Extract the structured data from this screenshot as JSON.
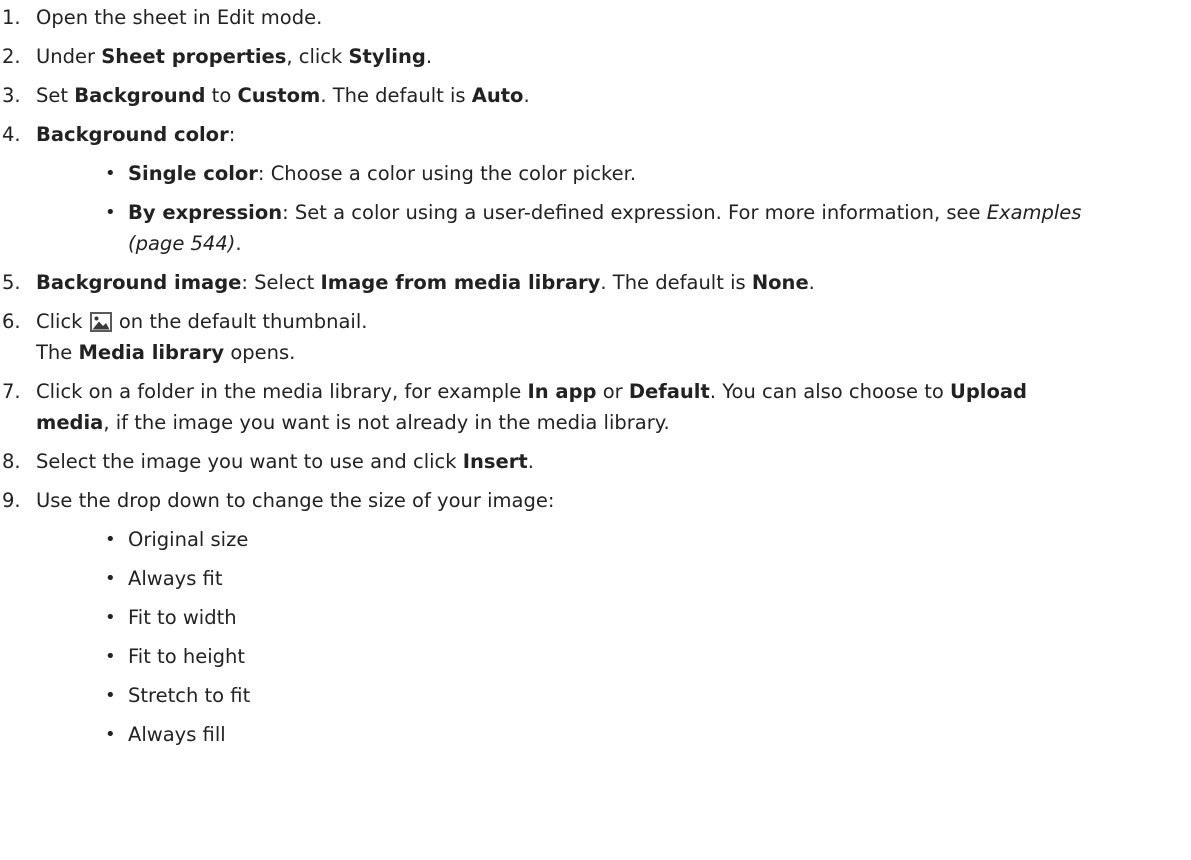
{
  "steps": [
    {
      "num": "1.",
      "parts": [
        {
          "t": "Open the sheet in Edit mode."
        }
      ]
    },
    {
      "num": "2.",
      "parts": [
        {
          "t": "Under "
        },
        {
          "t": "Sheet properties",
          "b": true
        },
        {
          "t": ", click "
        },
        {
          "t": "Styling",
          "b": true
        },
        {
          "t": "."
        }
      ]
    },
    {
      "num": "3.",
      "parts": [
        {
          "t": "Set "
        },
        {
          "t": "Background",
          "b": true
        },
        {
          "t": " to "
        },
        {
          "t": "Custom",
          "b": true
        },
        {
          "t": ". The default is "
        },
        {
          "t": "Auto",
          "b": true
        },
        {
          "t": "."
        }
      ]
    },
    {
      "num": "4.",
      "parts": [
        {
          "t": "Background color",
          "b": true
        },
        {
          "t": ":"
        }
      ]
    },
    {
      "num": "5.",
      "parts": [
        {
          "t": "Background image",
          "b": true
        },
        {
          "t": ": Select "
        },
        {
          "t": "Image from media library",
          "b": true
        },
        {
          "t": ". The default is "
        },
        {
          "t": "None",
          "b": true
        },
        {
          "t": "."
        }
      ]
    },
    {
      "num": "6.",
      "line1_before": "Click ",
      "line1_after": " on the default thumbnail.",
      "line2": [
        {
          "t": "The "
        },
        {
          "t": "Media library",
          "b": true
        },
        {
          "t": " opens."
        }
      ]
    },
    {
      "num": "7.",
      "line1": [
        {
          "t": "Click on a folder in the media library, for example "
        },
        {
          "t": "In app",
          "b": true
        },
        {
          "t": " or "
        },
        {
          "t": "Default",
          "b": true
        },
        {
          "t": ". You can also choose to "
        },
        {
          "t": "Upload",
          "b": true
        }
      ],
      "line2": [
        {
          "t": "media",
          "b": true
        },
        {
          "t": ", if the image you want is not already in the media library."
        }
      ]
    },
    {
      "num": "8.",
      "parts": [
        {
          "t": "Select the image you want to use and click "
        },
        {
          "t": "Insert",
          "b": true
        },
        {
          "t": "."
        }
      ]
    },
    {
      "num": "9.",
      "parts": [
        {
          "t": "Use the drop down to change the size of your image:"
        }
      ]
    }
  ],
  "color_options": [
    {
      "line1": [
        {
          "t": "Single color",
          "b": true
        },
        {
          "t": ": Choose a color using the color picker."
        }
      ]
    },
    {
      "line1": [
        {
          "t": "By expression",
          "b": true
        },
        {
          "t": ": Set a color using a user-defined expression. For more information, see "
        },
        {
          "t": "Examples",
          "i": true
        }
      ],
      "line2": [
        {
          "t": "(page 544)",
          "i": true
        },
        {
          "t": "."
        }
      ]
    }
  ],
  "size_options": [
    "Original size",
    "Always fit",
    "Fit to width",
    "Fit to height",
    "Stretch to fit",
    "Always fill"
  ],
  "bullet_glyph": "•",
  "icon": "image-icon",
  "colors": {
    "text": "#222222",
    "icon_frame": "#5a5a5a"
  }
}
